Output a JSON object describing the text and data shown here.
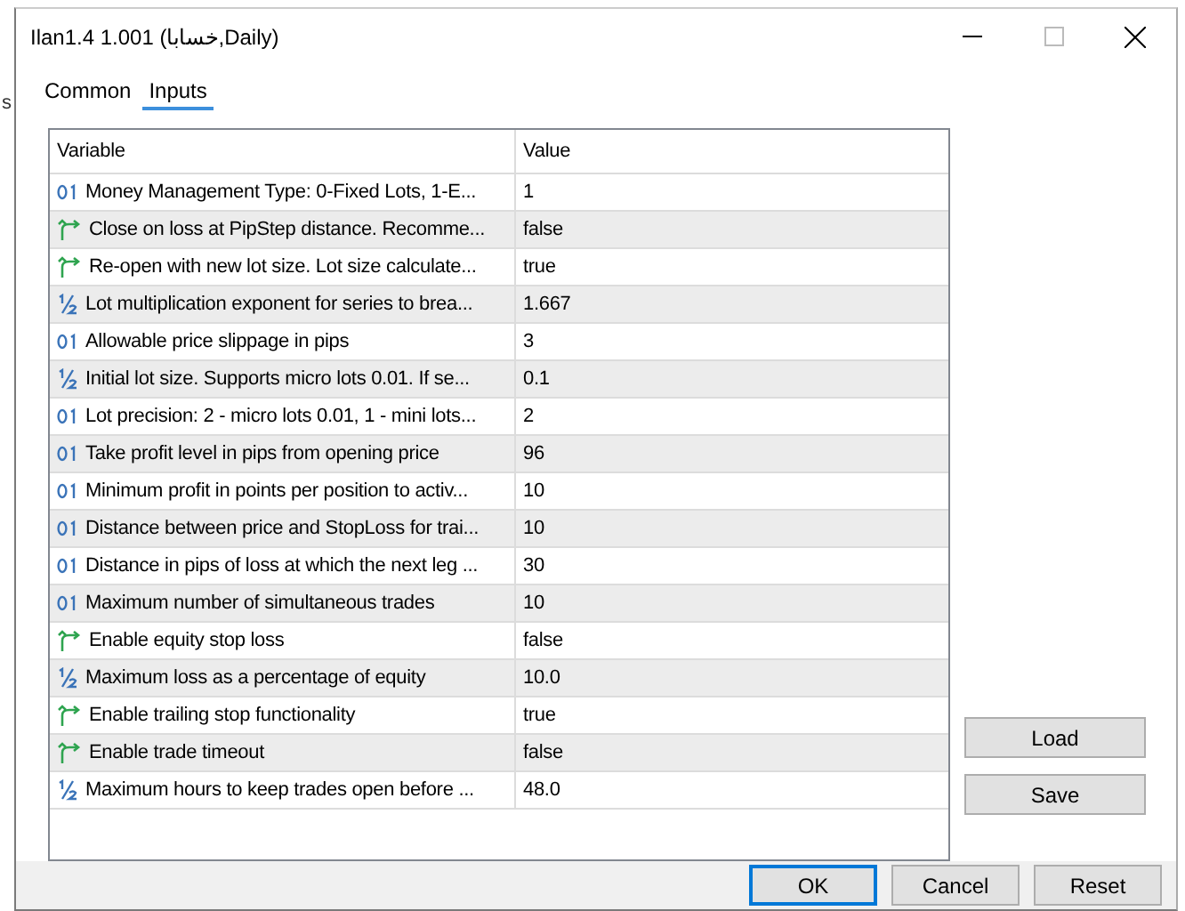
{
  "background_text": "s",
  "window": {
    "title": "Ilan1.4 1.001 (خسابا,Daily)"
  },
  "tabs": [
    {
      "label": "Common",
      "selected": false
    },
    {
      "label": "Inputs",
      "selected": true
    }
  ],
  "table": {
    "columns": [
      "Variable",
      "Value"
    ],
    "rows": [
      {
        "kind": "int",
        "variable": "Money Management Type: 0-Fixed Lots, 1-E...",
        "value": "1"
      },
      {
        "kind": "bool",
        "variable": "Close on loss at PipStep distance. Recomme...",
        "value": "false"
      },
      {
        "kind": "bool",
        "variable": "Re-open with new lot size. Lot size calculate...",
        "value": "true"
      },
      {
        "kind": "double",
        "variable": "Lot multiplication exponent for series to brea...",
        "value": "1.667"
      },
      {
        "kind": "int",
        "variable": "Allowable price slippage in pips",
        "value": "3"
      },
      {
        "kind": "double",
        "variable": "Initial lot size. Supports micro lots 0.01. If se...",
        "value": "0.1"
      },
      {
        "kind": "int",
        "variable": "Lot precision: 2 - micro lots 0.01, 1 - mini lots...",
        "value": "2"
      },
      {
        "kind": "int",
        "variable": "Take profit level in pips from opening price",
        "value": "96"
      },
      {
        "kind": "int",
        "variable": "Minimum profit in points per position to activ...",
        "value": "10"
      },
      {
        "kind": "int",
        "variable": "Distance between price and StopLoss for trai...",
        "value": "10"
      },
      {
        "kind": "int",
        "variable": "Distance in pips of loss at which the next leg ...",
        "value": "30"
      },
      {
        "kind": "int",
        "variable": "Maximum number of simultaneous trades",
        "value": "10"
      },
      {
        "kind": "bool",
        "variable": "Enable equity stop loss",
        "value": "false"
      },
      {
        "kind": "double",
        "variable": "Maximum loss as a percentage of equity",
        "value": "10.0"
      },
      {
        "kind": "bool",
        "variable": "Enable trailing stop functionality",
        "value": "true"
      },
      {
        "kind": "bool",
        "variable": "Enable trade timeout",
        "value": "false"
      },
      {
        "kind": "double",
        "variable": "Maximum hours to keep trades open before ...",
        "value": "48.0"
      }
    ]
  },
  "side_buttons": [
    "Load",
    "Save"
  ],
  "buttons": [
    {
      "label": "OK",
      "default": true
    },
    {
      "label": "Cancel",
      "default": false
    },
    {
      "label": "Reset",
      "default": false
    }
  ]
}
